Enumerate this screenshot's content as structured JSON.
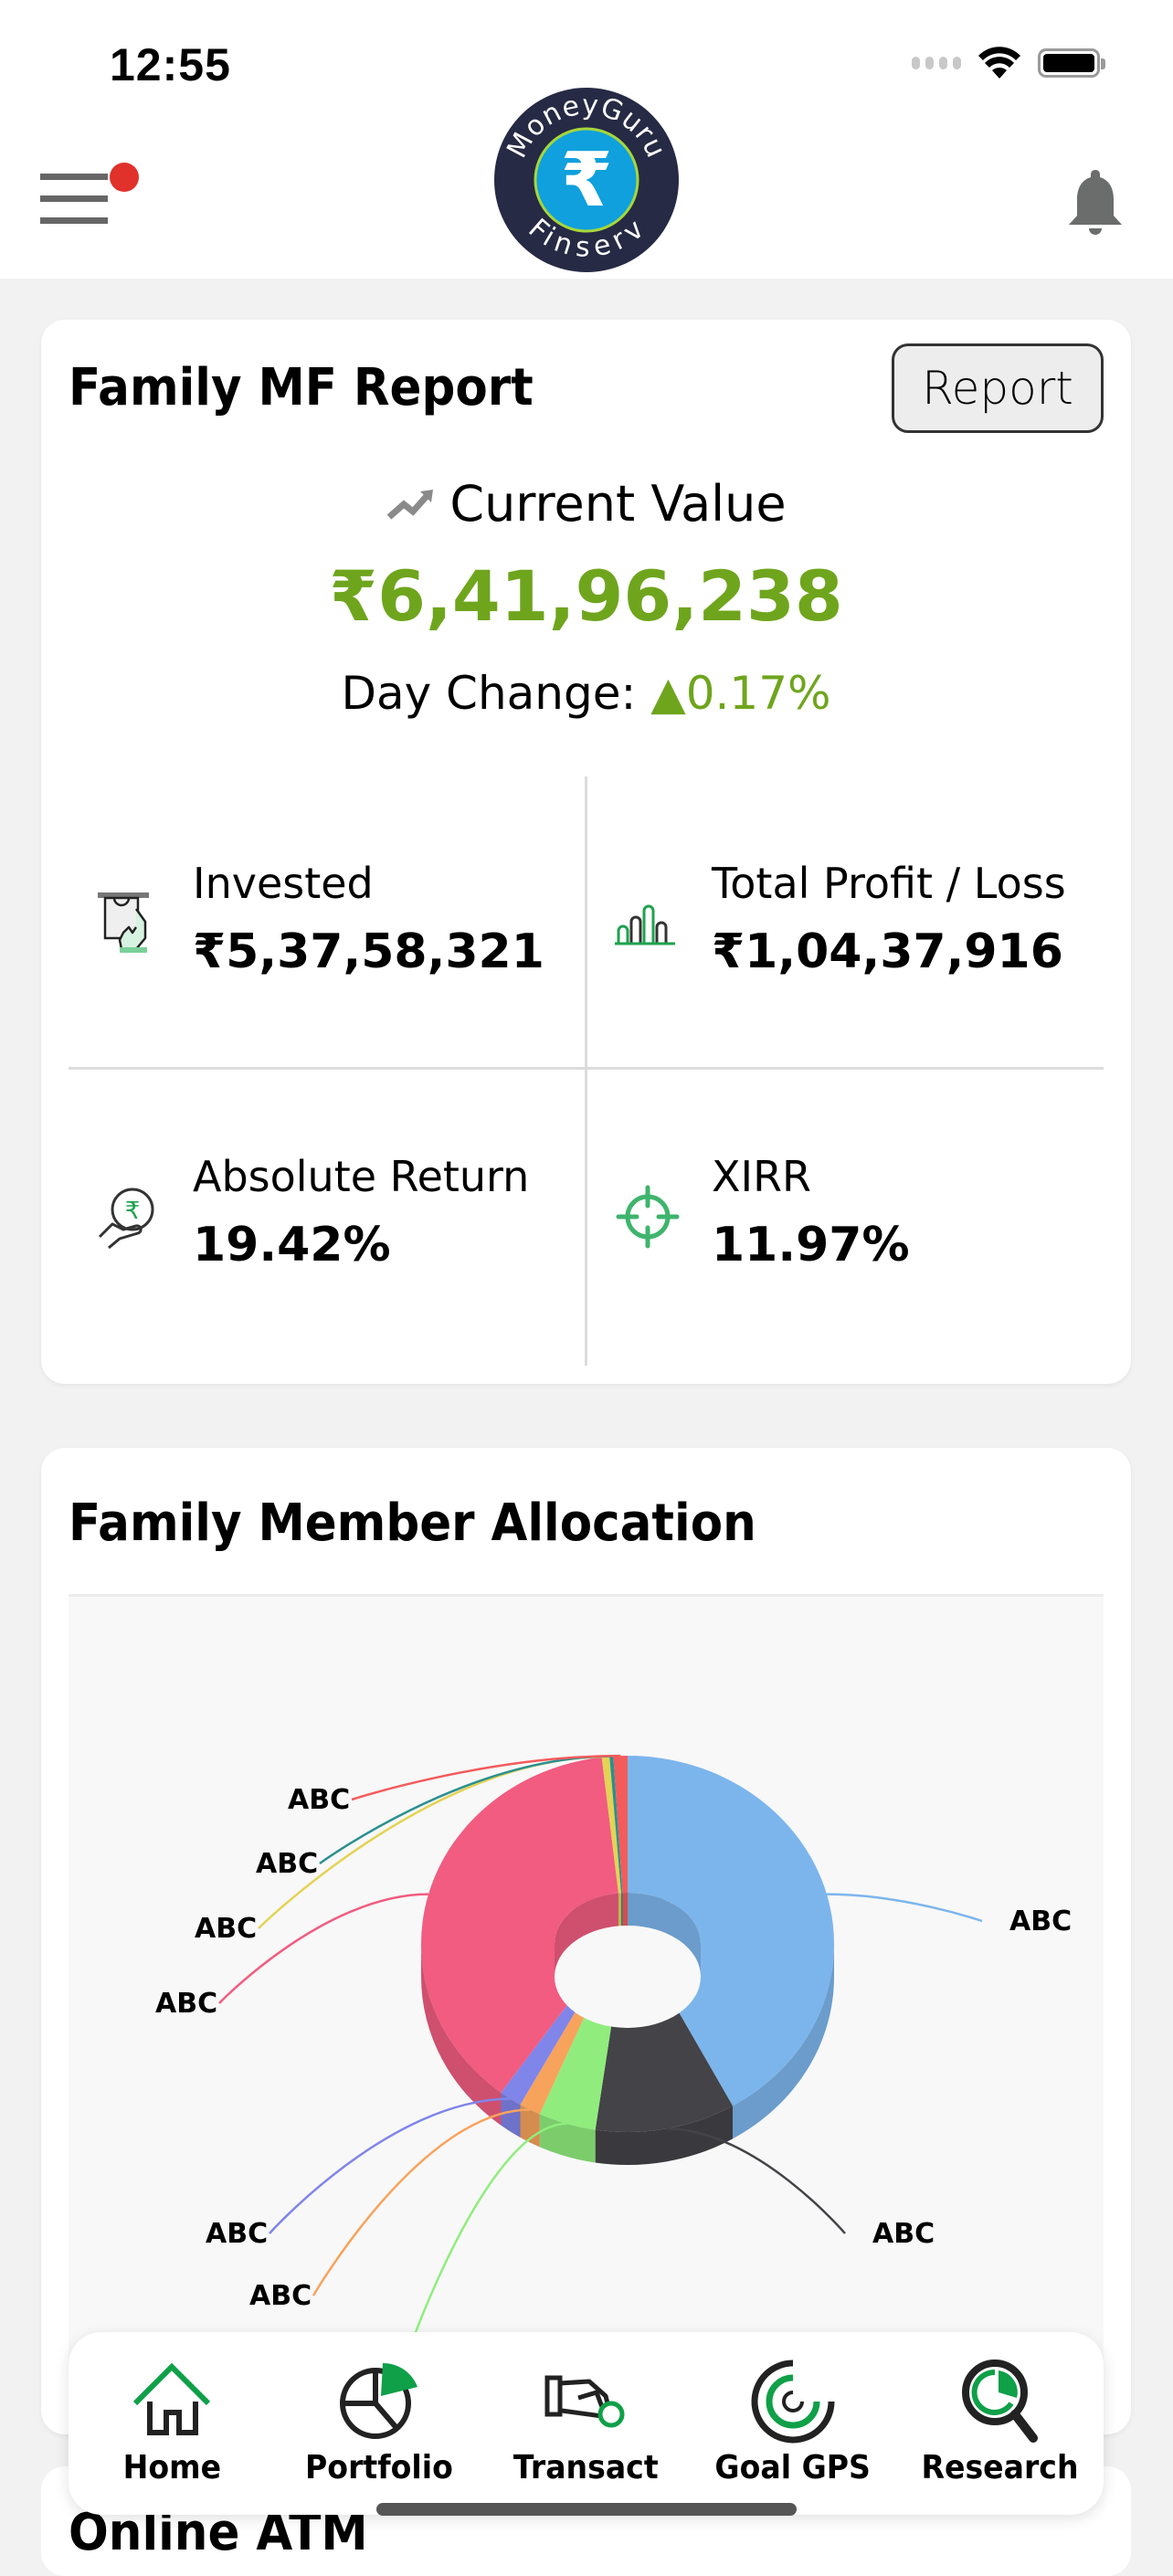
{
  "status_bar": {
    "time": "12:55"
  },
  "header": {
    "logo_text_top": "MoneyGuru",
    "logo_text_bottom": "Finserv",
    "menu_icon": "hamburger-menu-icon",
    "notification_icon": "bell-icon",
    "has_menu_badge": true
  },
  "report_card": {
    "title": "Family MF Report",
    "report_button": "Report",
    "current_value_label": "Current Value",
    "current_value": "₹6,41,96,238",
    "day_change_label": "Day Change:",
    "day_change_value": "▲0.17%",
    "stats": [
      {
        "label": "Invested",
        "value": "₹5,37,58,321",
        "icon": "cash-in-hand-icon"
      },
      {
        "label": "Total Profit / Loss",
        "value": "₹1,04,37,916",
        "icon": "bar-chart-icon"
      },
      {
        "label": "Absolute Return",
        "value": "19.42%",
        "icon": "rupee-hand-icon"
      },
      {
        "label": "XIRR",
        "value": "11.97%",
        "icon": "target-icon"
      }
    ]
  },
  "allocation_card": {
    "title": "Family Member Allocation"
  },
  "chart_data": {
    "type": "pie",
    "variant": "3d-donut",
    "title": "Family Member Allocation",
    "categories": [
      "ABC",
      "ABC",
      "ABC",
      "ABC",
      "ABC",
      "ABC",
      "ABC",
      "ABC",
      "ABC"
    ],
    "values": [
      41.5,
      11,
      4.5,
      1.7,
      1.8,
      37.5,
      0.6,
      0.3,
      1.1
    ],
    "colors": [
      "#7cb5ec",
      "#434348",
      "#90ed7d",
      "#f7a35c",
      "#8085e9",
      "#f15c80",
      "#e4d354",
      "#2b908f",
      "#f45b5b"
    ],
    "legend": "none",
    "data_labels": "outside with connectors"
  },
  "next_section": {
    "title": "Online ATM"
  },
  "bottom_nav": [
    {
      "label": "Home",
      "icon": "home-icon"
    },
    {
      "label": "Portfolio",
      "icon": "pie-chart-icon"
    },
    {
      "label": "Transact",
      "icon": "hand-coin-icon"
    },
    {
      "label": "Goal GPS",
      "icon": "goal-target-icon"
    },
    {
      "label": "Research",
      "icon": "magnifier-chart-icon"
    }
  ],
  "colors": {
    "accent_green": "#6fa51d",
    "icon_green": "#0fa048",
    "badge_red": "#e0312b"
  }
}
